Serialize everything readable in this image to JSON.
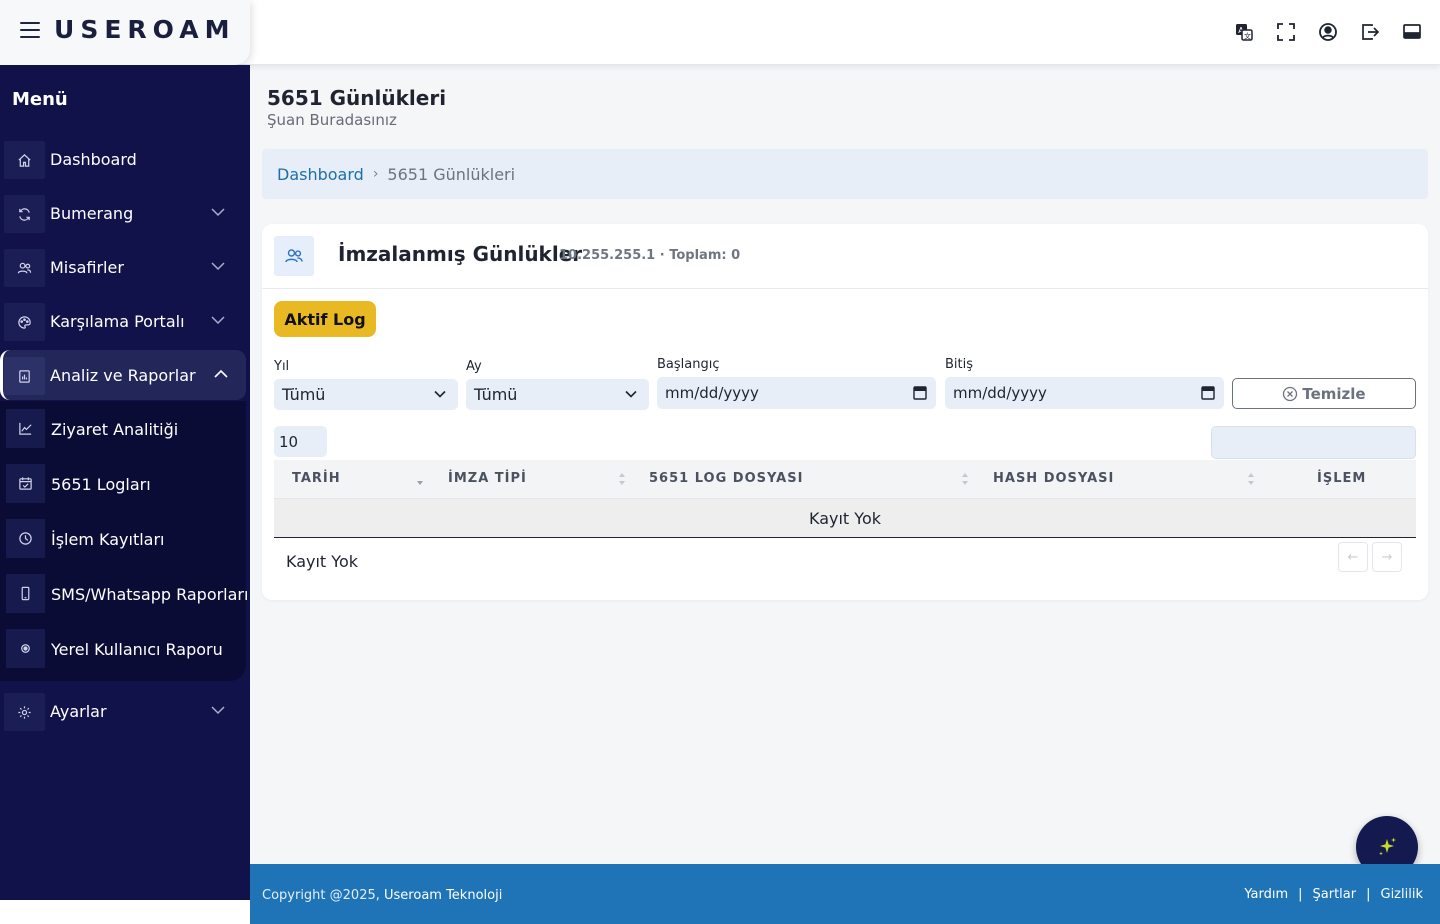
{
  "header": {
    "logo_text": "USEROAM",
    "icons": [
      "translate-icon",
      "fullscreen-icon",
      "user-circle-icon",
      "logout-icon",
      "screen-icon"
    ]
  },
  "sidebar": {
    "title": "Menü",
    "items": [
      {
        "label": "Dashboard",
        "icon": "home-icon"
      },
      {
        "label": "Bumerang",
        "icon": "refresh-icon"
      },
      {
        "label": "Misafirler",
        "icon": "users-icon"
      },
      {
        "label": "Karşılama Portalı",
        "icon": "palette-icon"
      },
      {
        "label": "Analiz ve Raporlar",
        "icon": "report-icon"
      },
      {
        "label": "Ayarlar",
        "icon": "gear-icon"
      }
    ],
    "submenu": [
      {
        "label": "Ziyaret Analitiği",
        "icon": "chart-line-icon"
      },
      {
        "label": "5651 Logları",
        "icon": "calendar-check-icon"
      },
      {
        "label": "İşlem Kayıtları",
        "icon": "clock-icon"
      },
      {
        "label": "SMS/Whatsapp Raporları",
        "icon": "phone-icon"
      },
      {
        "label": "Yerel Kullanıcı Raporu",
        "icon": "radio-dot-icon"
      }
    ]
  },
  "page": {
    "title": "5651 Günlükleri",
    "subtitle": "Şuan Buradasınız"
  },
  "breadcrumb": {
    "home": "Dashboard",
    "sep": "›",
    "current": "5651 Günlükleri"
  },
  "card": {
    "title": "İmzalanmış Günlükler",
    "meta": "10.255.255.1 · Toplam: 0",
    "active_log_button": "Aktif Log"
  },
  "filters": {
    "year_label": "Yıl",
    "year_value": "Tümü",
    "month_label": "Ay",
    "month_value": "Tümü",
    "start_label": "Başlangıç",
    "start_placeholder": "mm/dd/yyyy",
    "end_label": "Bitiş",
    "end_placeholder": "mm/dd/yyyy",
    "clear_button": "Temizle"
  },
  "table": {
    "page_size": "10",
    "search_value": "",
    "columns": [
      "TARİH",
      "İMZA TİPİ",
      "5651 LOG DOSYASI",
      "HASH DOSYASI",
      "İŞLEM"
    ],
    "empty_text": "Kayıt Yok",
    "info_text": "Kayıt Yok",
    "prev": "←",
    "next": "→"
  },
  "footer": {
    "copyright": "Copyright @2025,",
    "company": "Useroam Teknoloji",
    "links": [
      "Yardım",
      "Şartlar",
      "Gizlilik"
    ],
    "sep": "|"
  },
  "colors": {
    "sidebar_bg": "#11124a",
    "accent_yellow": "#e8b923",
    "footer_blue": "#1f74b8",
    "link_blue": "#1d6fae"
  }
}
